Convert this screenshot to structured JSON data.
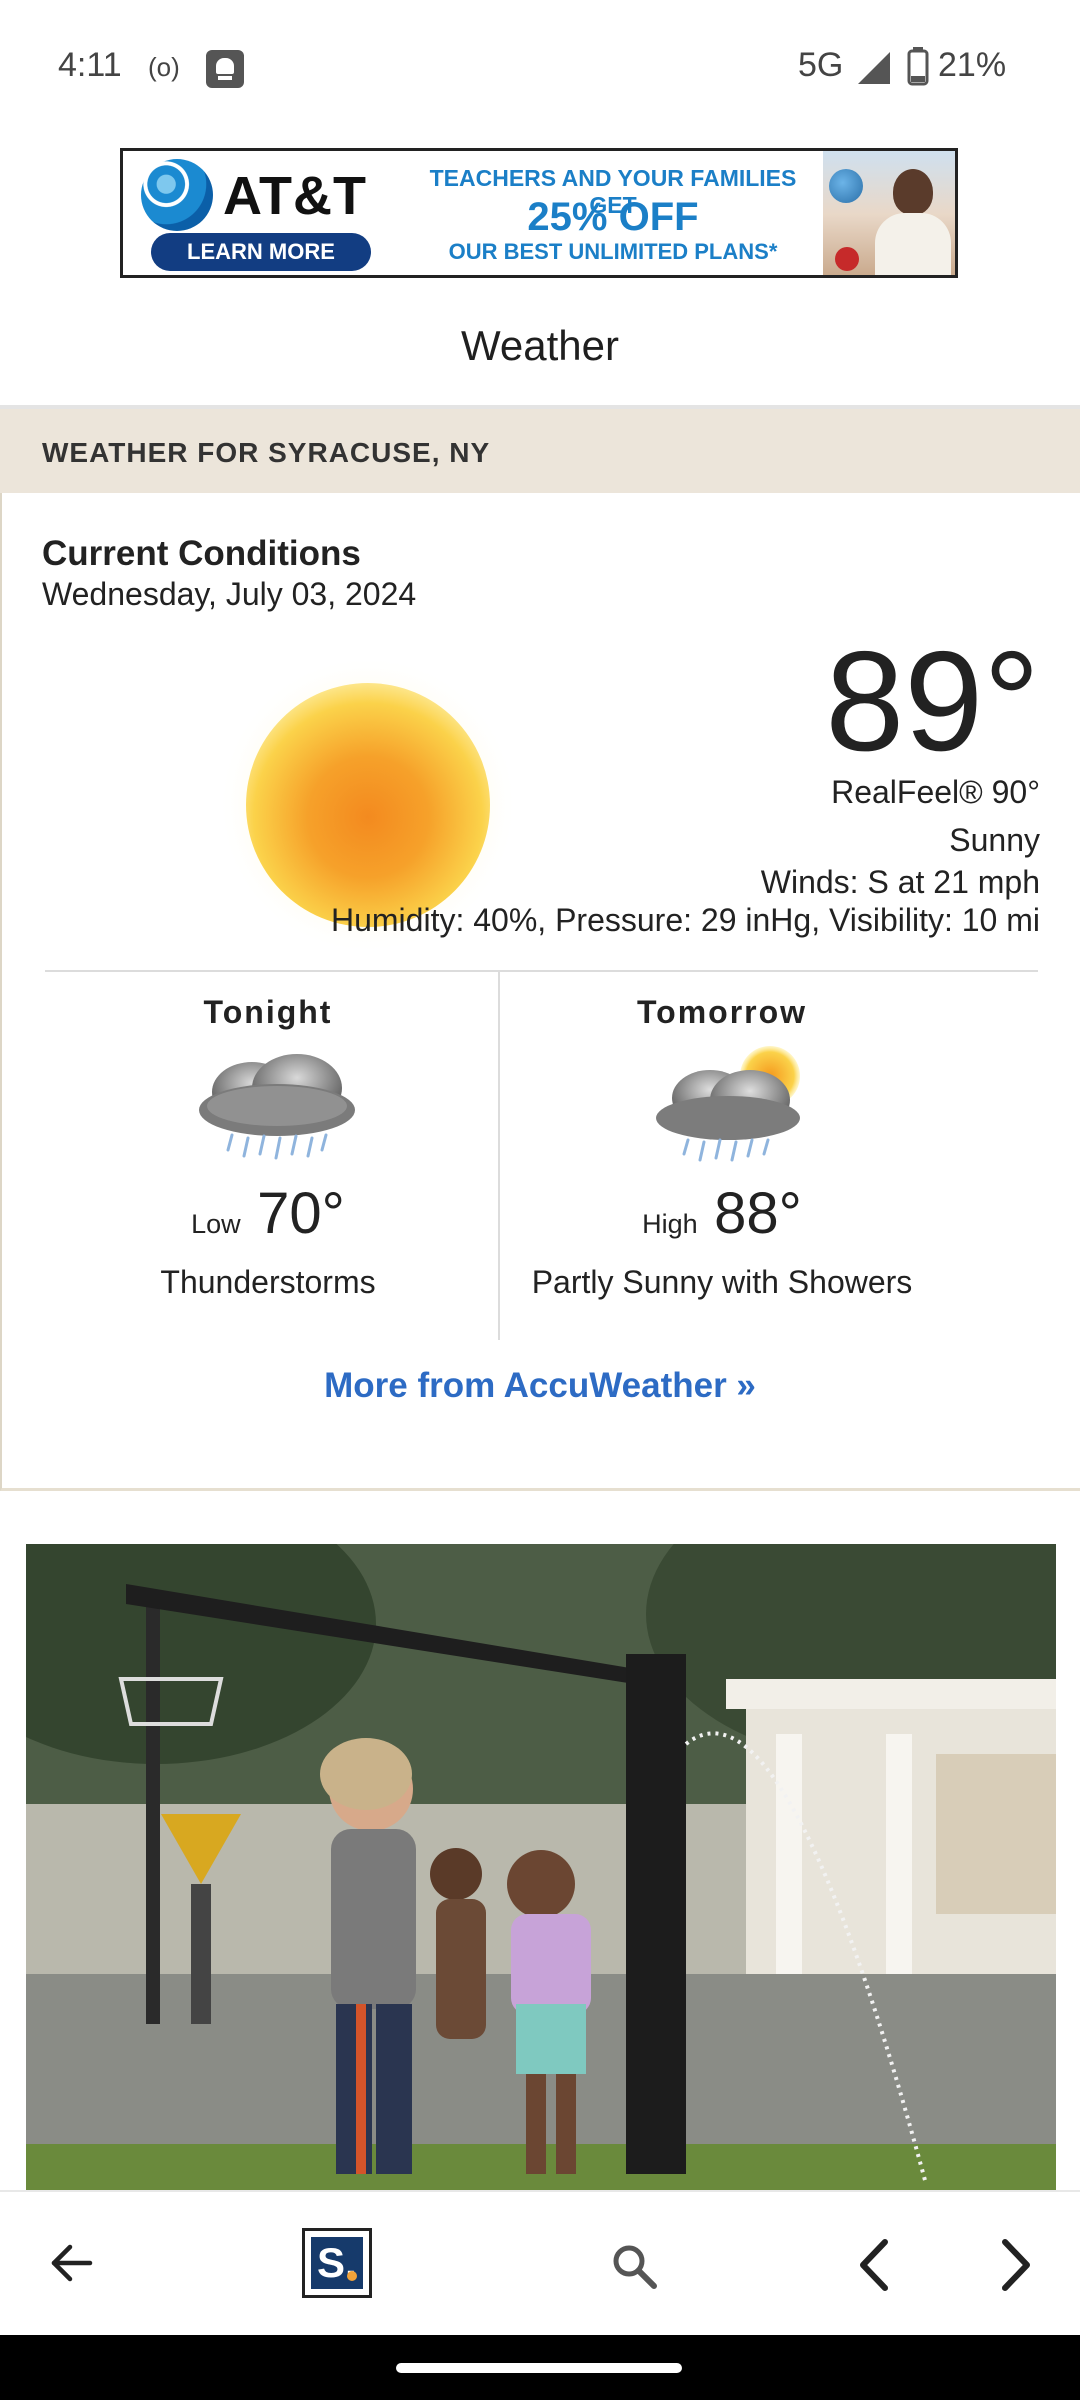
{
  "status_bar": {
    "time": "4:11",
    "hotspot_icon": "(o)",
    "network": "5G",
    "battery": "21%"
  },
  "ad": {
    "brand": "AT&T",
    "cta": "LEARN MORE",
    "line1": "TEACHERS AND YOUR FAMILIES GET",
    "line2": "25% OFF",
    "line3": "OUR BEST UNLIMITED PLANS*"
  },
  "header": {
    "title": "Weather"
  },
  "location_bar": {
    "text": "WEATHER FOR SYRACUSE, NY"
  },
  "current": {
    "heading": "Current Conditions",
    "date": "Wednesday, July 03, 2024",
    "icon": "sun-icon",
    "temperature": "89°",
    "realfeel": "RealFeel® 90°",
    "condition": "Sunny",
    "winds": "Winds: S at 21 mph",
    "details": "Humidity: 40%, Pressure: 29 inHg, Visibility: 10 mi"
  },
  "forecast": [
    {
      "label": "Tonight",
      "icon": "thunderstorm-icon",
      "temp_label": "Low",
      "temp": "70°",
      "condition": "Thunderstorms"
    },
    {
      "label": "Tomorrow",
      "icon": "partly-sunny-showers-icon",
      "temp_label": "High",
      "temp": "88°",
      "condition": "Partly Sunny with Showers"
    }
  ],
  "more_link": "More from AccuWeather »",
  "bottom_nav": {
    "back_icon": "arrow-back-icon",
    "logo_letter": "S.",
    "search_icon": "search-icon",
    "prev_icon": "chevron-left-icon",
    "next_icon": "chevron-right-icon"
  }
}
